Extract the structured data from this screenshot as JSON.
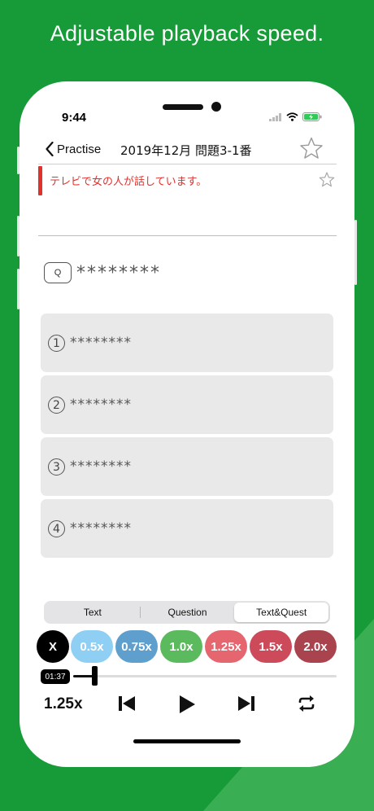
{
  "promo": {
    "headline": "Adjustable playback speed."
  },
  "status_bar": {
    "time": "9:44",
    "icons": [
      "signal-icon",
      "wifi-icon",
      "battery-charging-icon"
    ]
  },
  "nav": {
    "back_label": "Practise",
    "title": "2019年12月 問題3-1番",
    "star_icon": "star-outline-icon"
  },
  "sentence": {
    "text": "テレビで女の人が話しています。",
    "star_icon": "star-outline-icon"
  },
  "question": {
    "badge": "Q",
    "text": "********"
  },
  "options": [
    {
      "num": "1",
      "text": "********"
    },
    {
      "num": "2",
      "text": "********"
    },
    {
      "num": "3",
      "text": "********"
    },
    {
      "num": "4",
      "text": "********"
    }
  ],
  "display_mode": {
    "tabs": [
      "Text",
      "Question",
      "Text&Quest"
    ],
    "selected_index": 2
  },
  "speed": {
    "close_label": "X",
    "options": [
      {
        "label": "0.5x",
        "color": "#8ecff3"
      },
      {
        "label": "0.75x",
        "color": "#5f9fce"
      },
      {
        "label": "1.0x",
        "color": "#5cba5e"
      },
      {
        "label": "1.25x",
        "color": "#e5666f"
      },
      {
        "label": "1.5x",
        "color": "#cc4a5a"
      },
      {
        "label": "2.0x",
        "color": "#a9434e"
      }
    ]
  },
  "player": {
    "elapsed": "01:37",
    "progress": 0.08,
    "current_speed": "1.25x",
    "controls": [
      "skip-back-icon",
      "play-icon",
      "skip-forward-icon",
      "repeat-icon"
    ]
  },
  "colors": {
    "background": "#179b39",
    "accent_red": "#e0322d"
  }
}
